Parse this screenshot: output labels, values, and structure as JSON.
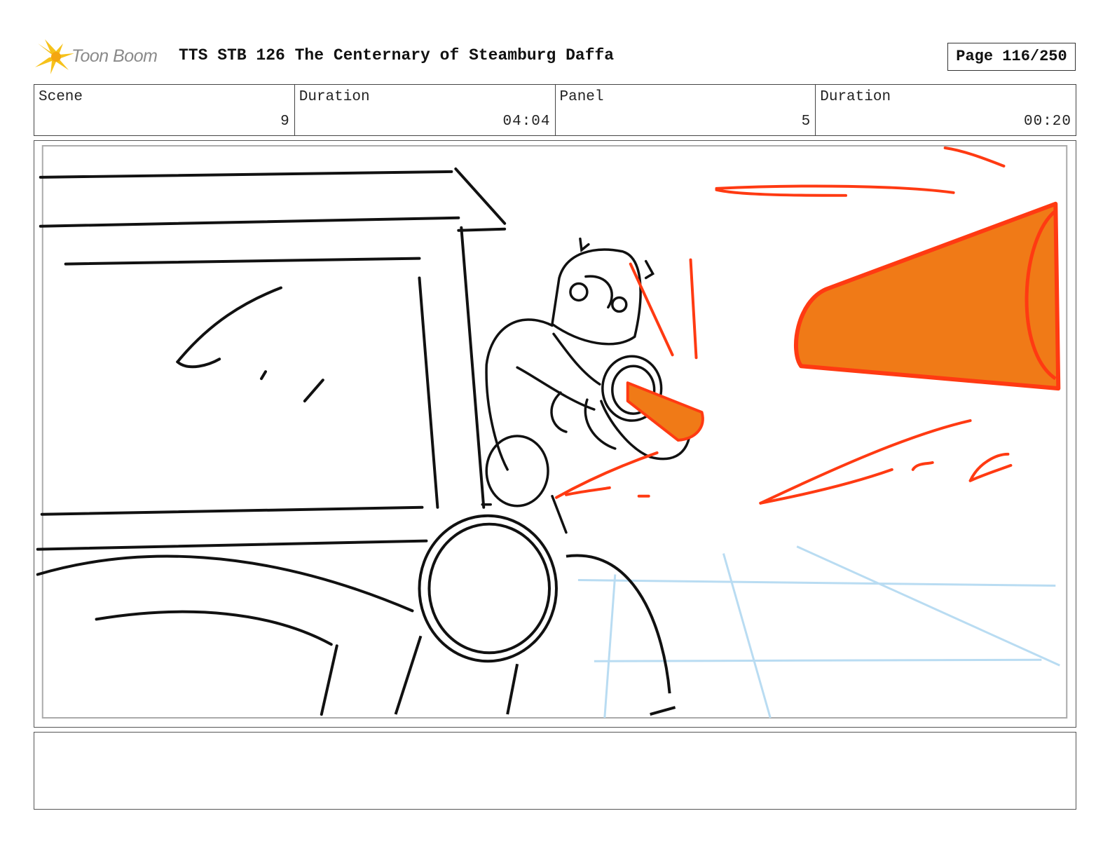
{
  "header": {
    "logo_text": "Toon Boom",
    "title": "TTS STB 126 The Centernary of Steamburg Daffa",
    "page_label": "Page 116/250"
  },
  "info": [
    {
      "label": "Scene",
      "value": "9"
    },
    {
      "label": "Duration",
      "value": "04:04"
    },
    {
      "label": "Panel",
      "value": "5"
    },
    {
      "label": "Duration",
      "value": "00:20"
    }
  ],
  "colors": {
    "sketch_line": "#111111",
    "fire_orange": "#f07a17",
    "fire_red": "#ff3a12",
    "guide_blue": "#b9dcf2",
    "logo_yellow": "#f6c21b"
  },
  "notes": ""
}
